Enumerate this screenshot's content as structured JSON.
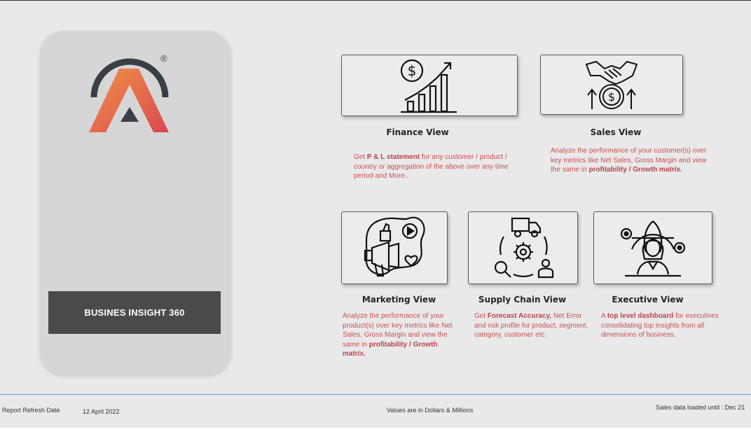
{
  "brand": {
    "title": "BUSINES INSIGHT 360",
    "registered_mark": "®"
  },
  "views": {
    "finance": {
      "title": "Finance View",
      "desc_pre": "Get ",
      "desc_bold": "P & L statement",
      "desc_post": " for any customer / product / country or aggregation of the above over any time period and More.."
    },
    "sales": {
      "title": "Sales View",
      "desc_pre": "Analyze the performance of your customer(s) over key metrics like Net Sales, Gross Margin and view the same in ",
      "desc_bold": "profitability / Growth matrix."
    },
    "marketing": {
      "title": "Marketing View",
      "desc_pre": "Analyze the performance of your product(s) over key metrics like Net Sales, Gross Margin and view the same in ",
      "desc_bold": "profitability / Growth matrix."
    },
    "supply_chain": {
      "title": "Supply Chain View",
      "desc_pre": "Get ",
      "desc_bold": "Forecast Accuracy,",
      "desc_post": " Net Error and risk profile for product, segment, category, customer etc."
    },
    "executive": {
      "title": "Executive View",
      "desc_pre": "A ",
      "desc_bold": "top level dashboard",
      "desc_post": " for executives consolidating top insights from all dimensions of business."
    }
  },
  "footer": {
    "refresh_label": "Report Refresh Date",
    "refresh_date": "12 April 2022",
    "units_note": "Values are in Dollars & Millions",
    "loaded_note": "Sales data loaded until : Dec 21"
  },
  "colors": {
    "accent_text": "#c9504c",
    "brand_box": "#4a4a4a",
    "logo_ring": "#3a3f46"
  },
  "icons": {
    "finance": "dollar-growth-chart-icon",
    "sales": "handshake-coin-icon",
    "marketing": "megaphone-social-icon",
    "supply_chain": "truck-gear-cycle-icon",
    "executive": "executive-globe-icon"
  }
}
